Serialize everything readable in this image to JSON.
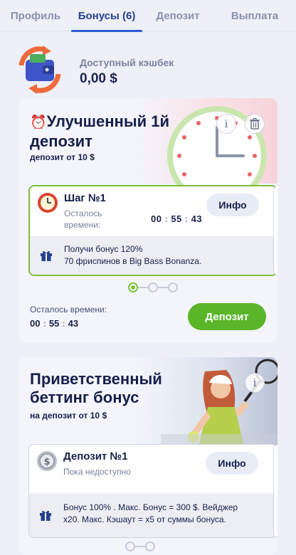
{
  "tabs": [
    {
      "label": "Профиль",
      "active": false
    },
    {
      "label": "Бонусы (6)",
      "active": true
    },
    {
      "label": "Депозит",
      "active": false
    },
    {
      "label": "Выплата",
      "active": false
    }
  ],
  "cashback": {
    "label": "Доступный кэшбек",
    "value": "0,00 $"
  },
  "card1": {
    "emoji": "⏰",
    "title_line1": "Улучшенный 1й",
    "title_line2": "депозит",
    "subtitle": "депозит от 10 $",
    "step": {
      "title": "Шаг №1",
      "remaining_line1": "Осталось",
      "remaining_line2": "времени:",
      "timer": {
        "h": "00",
        "m": "55",
        "s": "43"
      },
      "info_label": "Инфо",
      "bonus_line1": "Получи бонус 120%",
      "bonus_line2": "70 фриспинов в Big Bass Bonanza."
    },
    "remaining_label": "Осталось времени:",
    "remaining_timer": {
      "h": "00",
      "m": "55",
      "s": "43"
    },
    "deposit_label": "Депозит"
  },
  "card2": {
    "title_line1": "Приветственный",
    "title_line2": "беттинг бонус",
    "subtitle": "на депозит от 10 $",
    "step": {
      "title": "Депозит №1",
      "status": "Пока недоступно",
      "info_label": "Инфо",
      "bonus_line1": "Бонус 100% . Макс. Бонус = 300 $. Вейджер",
      "bonus_line2": "x20. Макс. Кэшаут = x5 от суммы бонуса."
    }
  },
  "colors": {
    "accent": "#2e5bd8",
    "green": "#5ab528",
    "active_border": "#7cbf3a"
  },
  "icons": [
    "wallet-refresh-icon",
    "alarm-clock-icon",
    "info-icon",
    "trash-icon",
    "clock-icon",
    "coin-icon",
    "gift-icon"
  ]
}
